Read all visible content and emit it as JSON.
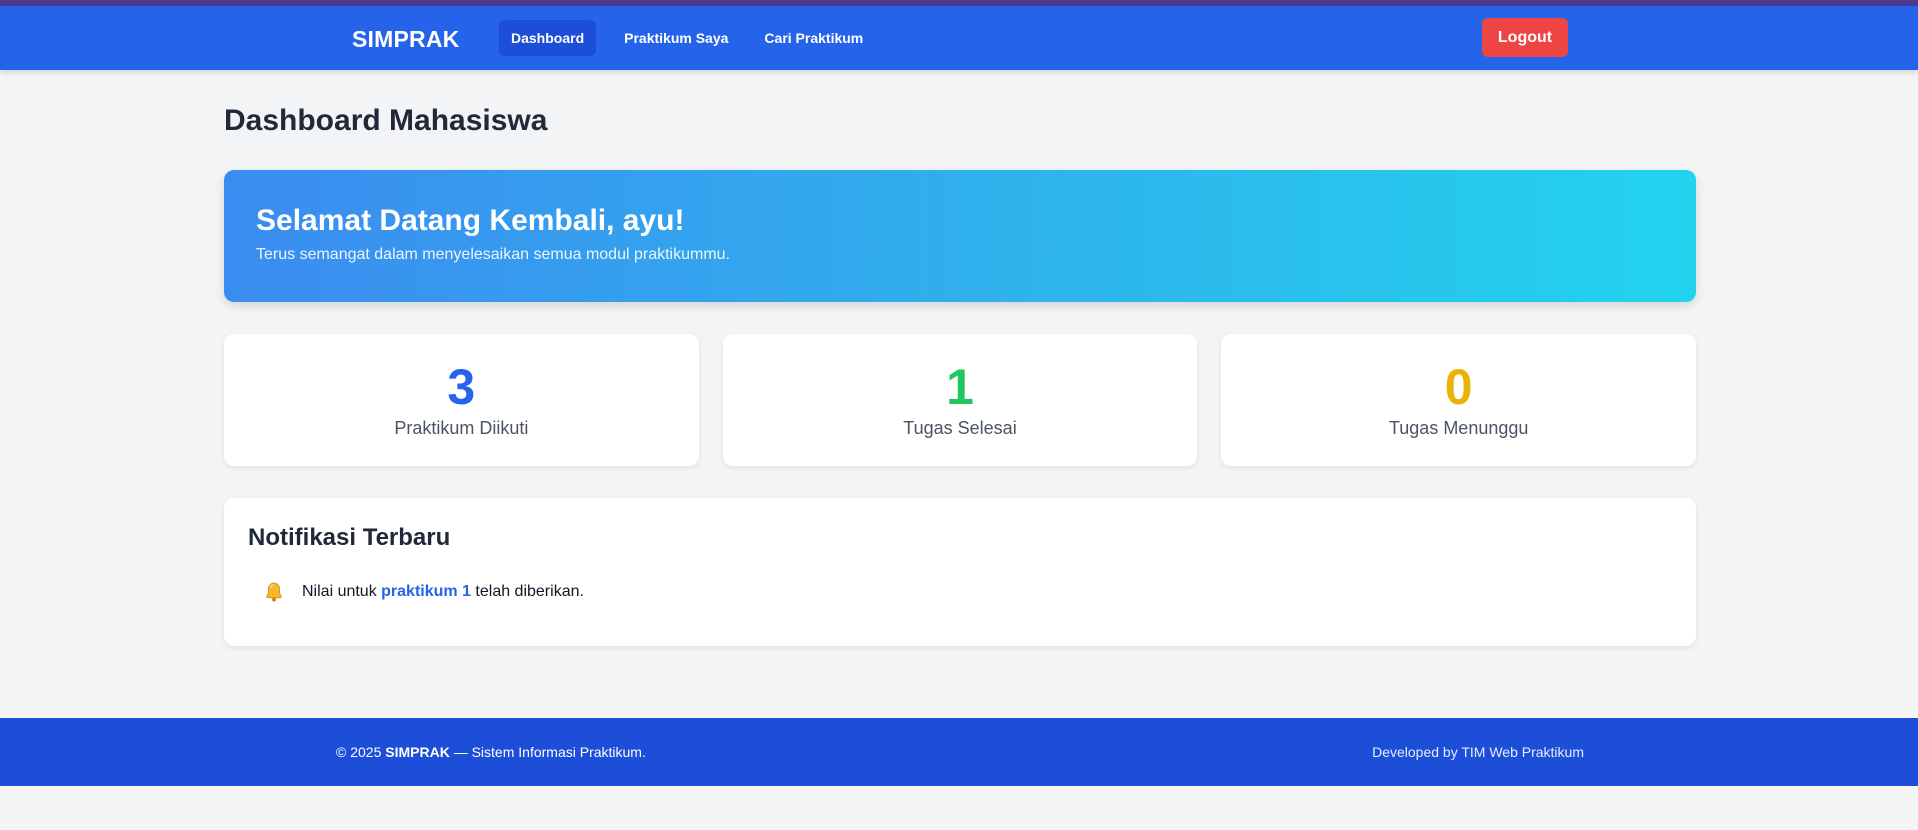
{
  "app": {
    "brand": "SIMPRAK"
  },
  "nav": {
    "items": [
      {
        "label": "Dashboard",
        "active": true
      },
      {
        "label": "Praktikum Saya",
        "active": false
      },
      {
        "label": "Cari Praktikum",
        "active": false
      }
    ],
    "logout_label": "Logout"
  },
  "page": {
    "title": "Dashboard Mahasiswa"
  },
  "welcome": {
    "heading": "Selamat Datang Kembali, ayu!",
    "subtext": "Terus semangat dalam menyelesaikan semua modul praktikummu."
  },
  "stats": [
    {
      "value": "3",
      "label": "Praktikum Diikuti",
      "color": "#2563eb"
    },
    {
      "value": "1",
      "label": "Tugas Selesai",
      "color": "#22c55e"
    },
    {
      "value": "0",
      "label": "Tugas Menunggu",
      "color": "#eab308"
    }
  ],
  "notifications": {
    "title": "Notifikasi Terbaru",
    "items": [
      {
        "icon": "bell-icon",
        "prefix": "Nilai untuk ",
        "link": "praktikum 1",
        "suffix": " telah diberikan."
      }
    ]
  },
  "footer": {
    "copyright_prefix": "© 2025 ",
    "copyright_brand": "SIMPRAK",
    "copyright_suffix": " — Sistem Informasi Praktikum.",
    "credit": "Developed by TIM Web Praktikum"
  },
  "colors": {
    "primary": "#2563eb",
    "footer": "#1d4ed8",
    "logout": "#ef4444"
  }
}
